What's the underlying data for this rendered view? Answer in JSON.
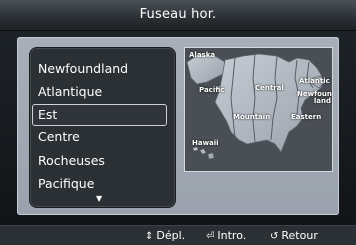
{
  "header": {
    "title": "Fuseau hor."
  },
  "timezone_list": {
    "items": [
      {
        "label": "Newfoundland"
      },
      {
        "label": "Atlantique"
      },
      {
        "label": "Est"
      },
      {
        "label": "Centre"
      },
      {
        "label": "Rocheuses"
      },
      {
        "label": "Pacifique"
      }
    ],
    "selected": "Est",
    "more_indicator": "▼"
  },
  "map": {
    "labels": {
      "alaska": "Alaska",
      "pacific": "Pacific",
      "central": "Central",
      "atlantic": "Atlantic",
      "newfoundland": "Newfound-land",
      "mountain": "Mountain",
      "eastern": "Eastern",
      "hawaii": "Hawaii"
    }
  },
  "help_bar": {
    "move": {
      "icon": "up-down-arrow-icon",
      "label": "Dépl."
    },
    "enter": {
      "icon": "enter-icon",
      "label": "Intro."
    },
    "back": {
      "icon": "return-icon",
      "label": "Retour"
    }
  }
}
